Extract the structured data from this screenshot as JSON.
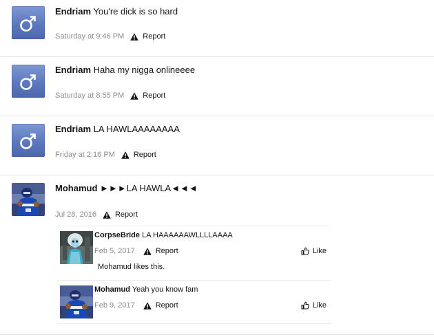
{
  "posts": [
    {
      "user": "Endriam",
      "text": "You're dick is so hard",
      "date": "Saturday at 9:46 PM",
      "report": "Report",
      "avatar": "male-symbol-icon"
    },
    {
      "user": "Endriam",
      "text": "Haha my nigga onlineeee",
      "date": "Saturday at 8:55 PM",
      "report": "Report",
      "avatar": "male-symbol-icon"
    },
    {
      "user": "Endriam",
      "text": "LA HAWLAAAAAAAA",
      "date": "Friday at 2:16 PM",
      "report": "Report",
      "avatar": "male-symbol-icon"
    },
    {
      "user": "Mohamud",
      "text": "►►►LA HAWLA◄◄◄",
      "date": "Jul 28, 2016",
      "report": "Report",
      "avatar": "football-player-photo"
    }
  ],
  "comments": [
    {
      "user": "CorpseBride",
      "text": "LA HAAAAAAWLLLLAAAA",
      "date": "Feb 5, 2017",
      "report": "Report",
      "like": "Like",
      "likes_text": "Mohamud likes this."
    },
    {
      "user": "Mohamud",
      "text": "Yeah you know fam",
      "date": "Feb 9, 2017",
      "report": "Report",
      "like": "Like"
    }
  ],
  "colors": {
    "male_avatar": "#5d79bd",
    "meta_text": "#8c8c8c",
    "divider": "#e3e3e3"
  }
}
